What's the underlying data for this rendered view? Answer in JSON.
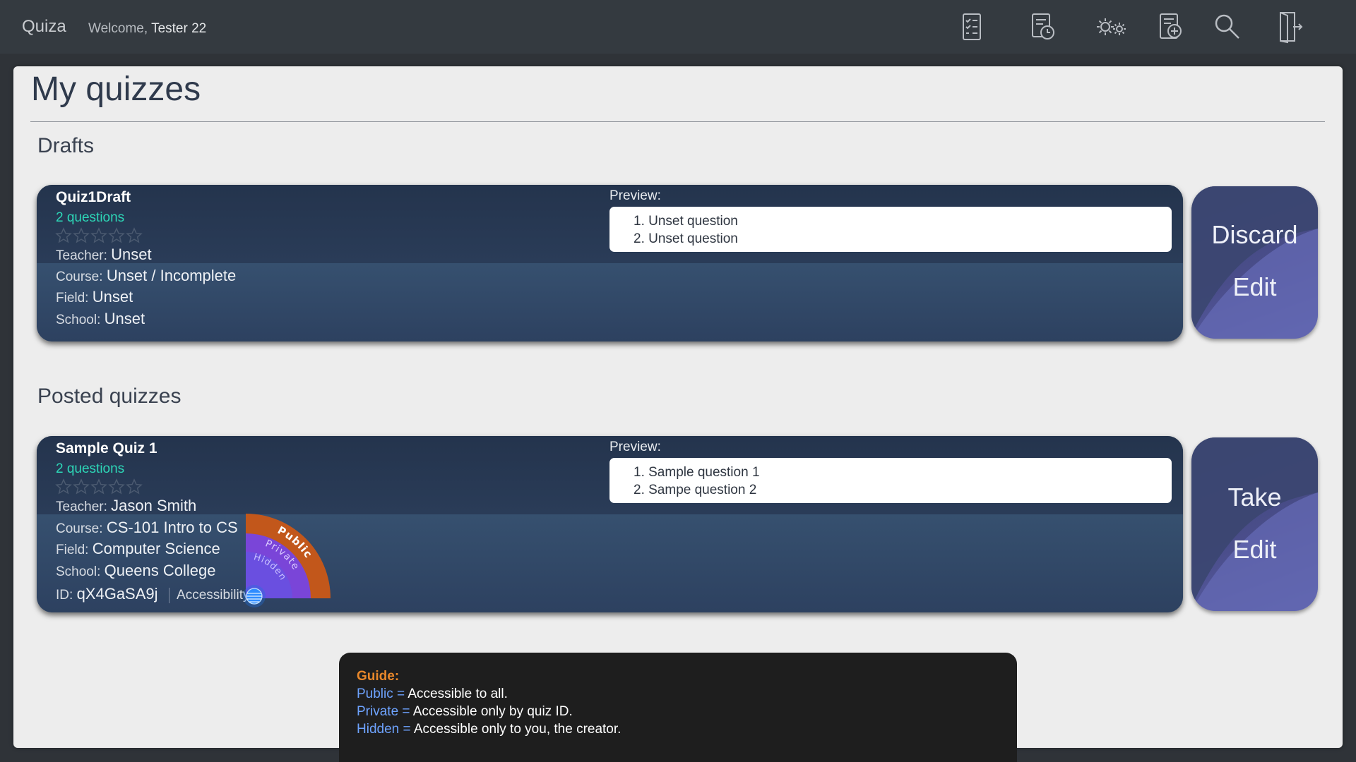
{
  "header": {
    "brand": "Quiza",
    "welcome_prefix": "Welcome,",
    "username": "Tester 22",
    "nav_icons": [
      "my-quizzes-icon",
      "history-icon",
      "settings-icon",
      "create-quiz-icon",
      "search-icon",
      "logout-icon"
    ]
  },
  "page": {
    "title": "My quizzes",
    "drafts_title": "Drafts",
    "posted_title": "Posted quizzes"
  },
  "labels": {
    "preview": "Preview:",
    "teacher": "Teacher:",
    "course": "Course:",
    "field": "Field:",
    "school": "School:",
    "id": "ID:",
    "accessibility": "Accessibility:"
  },
  "drafts": [
    {
      "name": "Quiz1Draft",
      "questions": "2 questions",
      "rating": 0,
      "teacher": "Unset",
      "course": "Unset / Incomplete",
      "field": "Unset",
      "school": "Unset",
      "preview": [
        "1. Unset question",
        "2. Unset question"
      ],
      "actions": [
        "Discard",
        "Edit"
      ]
    }
  ],
  "posted": [
    {
      "name": "Sample Quiz 1",
      "questions": "2 questions",
      "rating": 0,
      "teacher": "Jason Smith",
      "course": "CS-101 Intro to CS",
      "field": "Computer Science",
      "school": "Queens College",
      "id": "qX4GaSA9j",
      "accessibility_options": [
        "Public",
        "Private",
        "Hidden"
      ],
      "preview": [
        "1. Sample question 1",
        "2. Sampe question 2"
      ],
      "actions": [
        "Take",
        "Edit"
      ]
    }
  ],
  "guide": {
    "title": "Guide:",
    "items": [
      {
        "term": "Public =",
        "desc": "Accessible to all."
      },
      {
        "term": "Private =",
        "desc": "Accessible only by quiz ID."
      },
      {
        "term": "Hidden =",
        "desc": "Accessible only to you, the creator."
      }
    ]
  },
  "colors": {
    "topbar": "#343a40",
    "card": "#2b3f5c",
    "question_count": "#2dd8b8",
    "action_tile": "#4a4d8a",
    "guide_title": "#e8872a",
    "guide_term": "#6ea3ff",
    "public": "#c2571b",
    "private": "#7a45d8",
    "hidden": "#6a4fe0"
  }
}
